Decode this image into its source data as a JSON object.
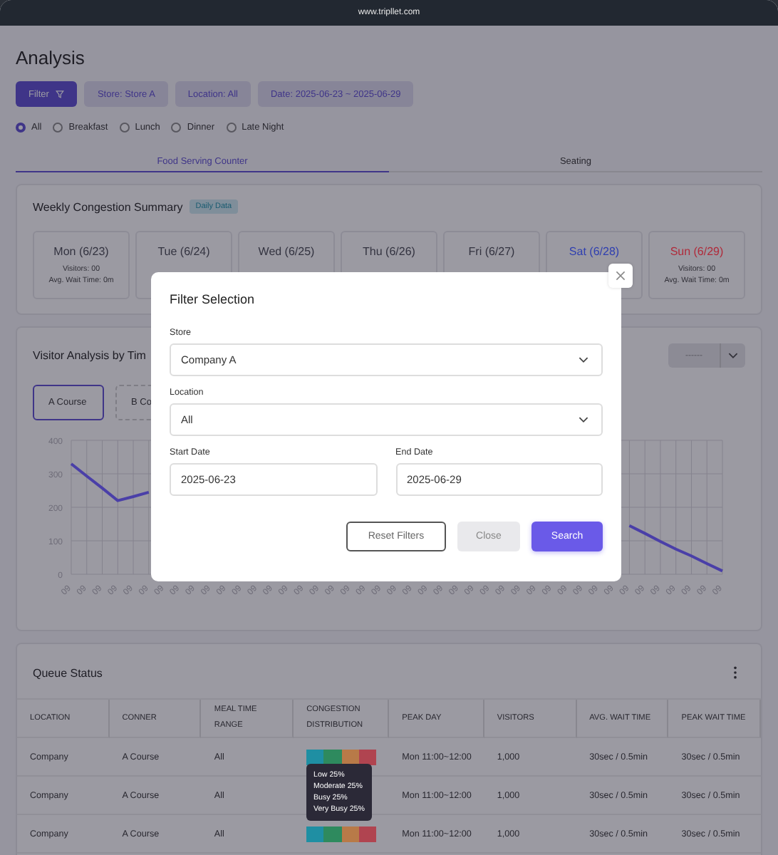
{
  "browser_bar": {
    "url": "www.tripllet.com"
  },
  "page_title": "Analysis",
  "filter_bar": {
    "filter_button": "Filter",
    "chips": [
      "Store: Store A",
      "Location: All",
      "Date: 2025-06-23 ~ 2025-06-29"
    ]
  },
  "meal_options": [
    {
      "label": "All",
      "selected": true
    },
    {
      "label": "Breakfast",
      "selected": false
    },
    {
      "label": "Lunch",
      "selected": false
    },
    {
      "label": "Dinner",
      "selected": false
    },
    {
      "label": "Late Night",
      "selected": false
    }
  ],
  "tabs": [
    {
      "label": "Food Serving Counter",
      "selected": true
    },
    {
      "label": "Seating",
      "selected": false
    }
  ],
  "weekly_summary": {
    "title": "Weekly Congestion Summary",
    "badge": "Daily Data",
    "days": [
      {
        "day": "Mon (6/23)",
        "color": "#333340",
        "visitors": "Visitors: 00",
        "wait": "Avg. Wait Time: 0m"
      },
      {
        "day": "Tue (6/24)",
        "color": "#333340"
      },
      {
        "day": "Wed (6/25)",
        "color": "#333340"
      },
      {
        "day": "Thu (6/26)",
        "color": "#333340"
      },
      {
        "day": "Fri (6/27)",
        "color": "#333340"
      },
      {
        "day": "Sat (6/28)",
        "color": "#2f3fb0"
      },
      {
        "day": "Sun (6/29)",
        "color": "#b02a3a",
        "visitors": "Visitors: 00",
        "wait": "Avg. Wait Time: 0m"
      }
    ]
  },
  "visitor_analysis": {
    "title": "Visitor Analysis by Tim",
    "dropdown": "------",
    "courses": [
      {
        "label": "A Course",
        "selected": true
      },
      {
        "label": "B Co",
        "selected": false
      }
    ],
    "chart_data": {
      "type": "line",
      "categories": [
        "09",
        "09",
        "09",
        "09",
        "09",
        "09",
        "09",
        "09",
        "09",
        "09",
        "09",
        "09",
        "09",
        "09",
        "09",
        "09",
        "09",
        "09",
        "09",
        "09",
        "09",
        "09",
        "09",
        "09",
        "09",
        "09",
        "09",
        "09",
        "09",
        "09",
        "09",
        "09",
        "09",
        "09",
        "09",
        "09",
        "09",
        "09",
        "09",
        "09",
        "09",
        "09",
        "09"
      ],
      "series": [
        {
          "color": "#4a3fa8",
          "values": [
            330,
            293,
            257,
            220,
            232,
            245,
            null,
            null,
            null,
            null,
            null,
            null,
            null,
            null,
            null,
            null,
            null,
            null,
            null,
            null,
            null,
            null,
            null,
            null,
            null,
            null,
            null,
            null,
            null,
            null,
            null,
            null,
            null,
            null,
            null,
            null,
            145,
            122,
            98,
            75,
            55,
            32,
            10
          ]
        }
      ],
      "ylim": [
        0,
        400
      ],
      "yticks": [
        0,
        100,
        200,
        300,
        400
      ],
      "grid": true
    }
  },
  "queue_status": {
    "title": "Queue Status",
    "columns": [
      "LOCATION",
      "CONNER",
      "MEAL TIME RANGE",
      "CONGESTION DISTRIBUTION",
      "PEAK DAY",
      "VISITORS",
      "AVG. WAIT TIME",
      "PEAK WAIT TIME"
    ],
    "rows": [
      {
        "location": "Company",
        "conner": "A Course",
        "meal_time": "All",
        "segments": [
          {
            "color": "#1f8fa3"
          },
          {
            "color": "#2e8a5e"
          },
          {
            "color": "#b87a48"
          },
          {
            "color": "#b04450"
          }
        ],
        "peak_day": "Mon 11:00~12:00",
        "visitors": "1,000",
        "avg_wait": "30sec / 0.5min",
        "peak_wait": "30sec / 0.5min"
      },
      {
        "location": "Company",
        "conner": "A Course",
        "meal_time": "All",
        "peak_day": "Mon 11:00~12:00",
        "visitors": "1,000",
        "avg_wait": "30sec / 0.5min",
        "peak_wait": "30sec / 0.5min"
      },
      {
        "location": "Company",
        "conner": "A Course",
        "meal_time": "All",
        "segments": [
          {
            "color": "#1f8fa3"
          },
          {
            "color": "#2e8a5e"
          },
          {
            "color": "#b87a48"
          },
          {
            "color": "#b04450"
          }
        ],
        "peak_day": "Mon 11:00~12:00",
        "visitors": "1,000",
        "avg_wait": "30sec / 0.5min",
        "peak_wait": "30sec / 0.5min"
      }
    ],
    "tooltip": [
      "Low 25%",
      "Moderate 25%",
      "Busy 25%",
      "Very Busy 25%"
    ]
  },
  "filter_dialog": {
    "title": "Filter Selection",
    "store_label": "Store",
    "store_value": "Company A",
    "location_label": "Location",
    "location_value": "All",
    "start_label": "Start Date",
    "start_value": "2025-06-23",
    "end_label": "End Date",
    "end_value": "2025-06-29",
    "buttons": [
      {
        "label": "Reset Filters",
        "kind": "outline"
      },
      {
        "label": "Close",
        "kind": "muted"
      },
      {
        "label": "Search",
        "kind": "primary"
      }
    ]
  }
}
